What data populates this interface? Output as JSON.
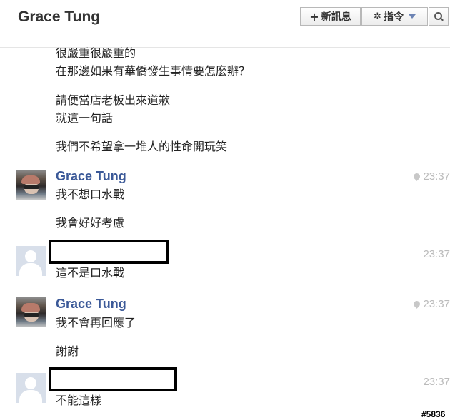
{
  "header": {
    "title": "Grace Tung",
    "new_message_label": "新訊息",
    "actions_label": "指令"
  },
  "messages_top": [
    "很嚴重很嚴重的",
    "在那邊如果有華僑發生事情要怎麼辦？",
    "請便當店老板出來道歉",
    "就這一句話",
    "我們不希望拿一堆人的性命開玩笑"
  ],
  "group_grace_1": {
    "sender": "Grace Tung",
    "time": "23:37",
    "lines": [
      "我不想口水戰",
      "我會好好考慮"
    ]
  },
  "group_other_1": {
    "time": "23:37",
    "lines": [
      "這不是口水戰"
    ]
  },
  "group_grace_2": {
    "sender": "Grace Tung",
    "time": "23:37",
    "lines": [
      "我不會再回應了",
      "謝謝"
    ]
  },
  "group_other_2": {
    "time": "23:37",
    "lines": [
      "不能這樣"
    ]
  },
  "watermark": "#5836"
}
